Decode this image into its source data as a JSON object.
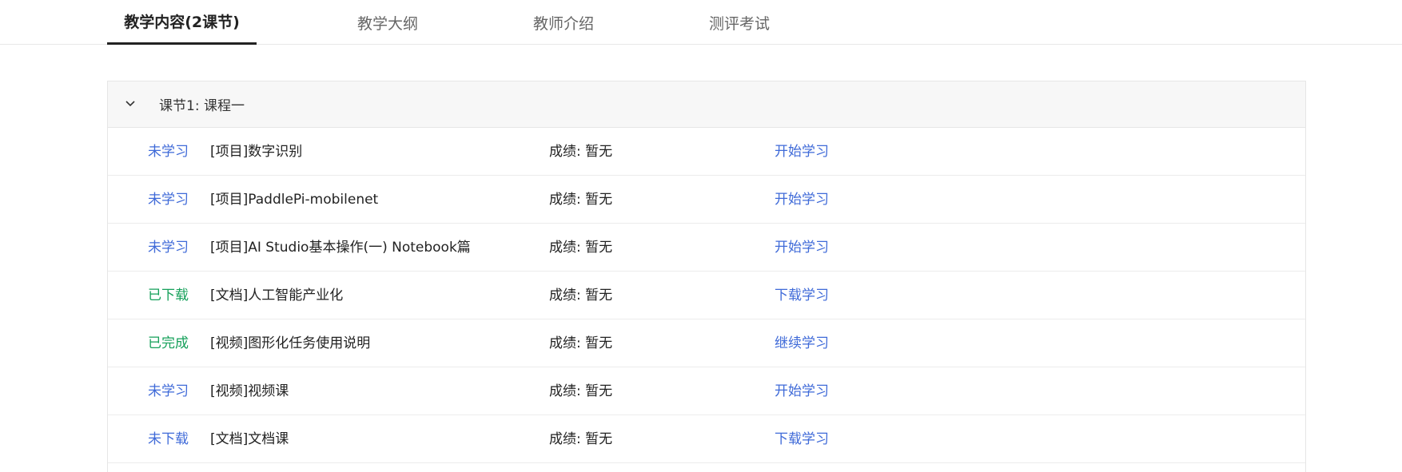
{
  "tabs": [
    {
      "label": "教学内容(2课节)",
      "active": true
    },
    {
      "label": "教学大纲",
      "active": false
    },
    {
      "label": "教师介绍",
      "active": false
    },
    {
      "label": "测评考试",
      "active": false
    }
  ],
  "section": {
    "title": "课节1: 课程一",
    "expand_icon": "chevron-down-icon"
  },
  "colors": {
    "blue": "#3f6ad8",
    "green": "#15a05a"
  },
  "rows": [
    {
      "status": "未学习",
      "status_color": "#3f6ad8",
      "title": "[项目]数字识别",
      "score": "成绩: 暂无",
      "action": "开始学习"
    },
    {
      "status": "未学习",
      "status_color": "#3f6ad8",
      "title": "[项目]PaddlePi-mobilenet",
      "score": "成绩: 暂无",
      "action": "开始学习"
    },
    {
      "status": "未学习",
      "status_color": "#3f6ad8",
      "title": "[项目]AI Studio基本操作(一) Notebook篇",
      "score": "成绩: 暂无",
      "action": "开始学习"
    },
    {
      "status": "已下载",
      "status_color": "#15a05a",
      "title": "[文档]人工智能产业化",
      "score": "成绩: 暂无",
      "action": "下载学习"
    },
    {
      "status": "已完成",
      "status_color": "#15a05a",
      "title": "[视频]图形化任务使用说明",
      "score": "成绩: 暂无",
      "action": "继续学习"
    },
    {
      "status": "未学习",
      "status_color": "#3f6ad8",
      "title": "[视频]视频课",
      "score": "成绩: 暂无",
      "action": "开始学习"
    },
    {
      "status": "未下载",
      "status_color": "#3f6ad8",
      "title": "[文档]文档课",
      "score": "成绩: 暂无",
      "action": "下载学习"
    }
  ]
}
